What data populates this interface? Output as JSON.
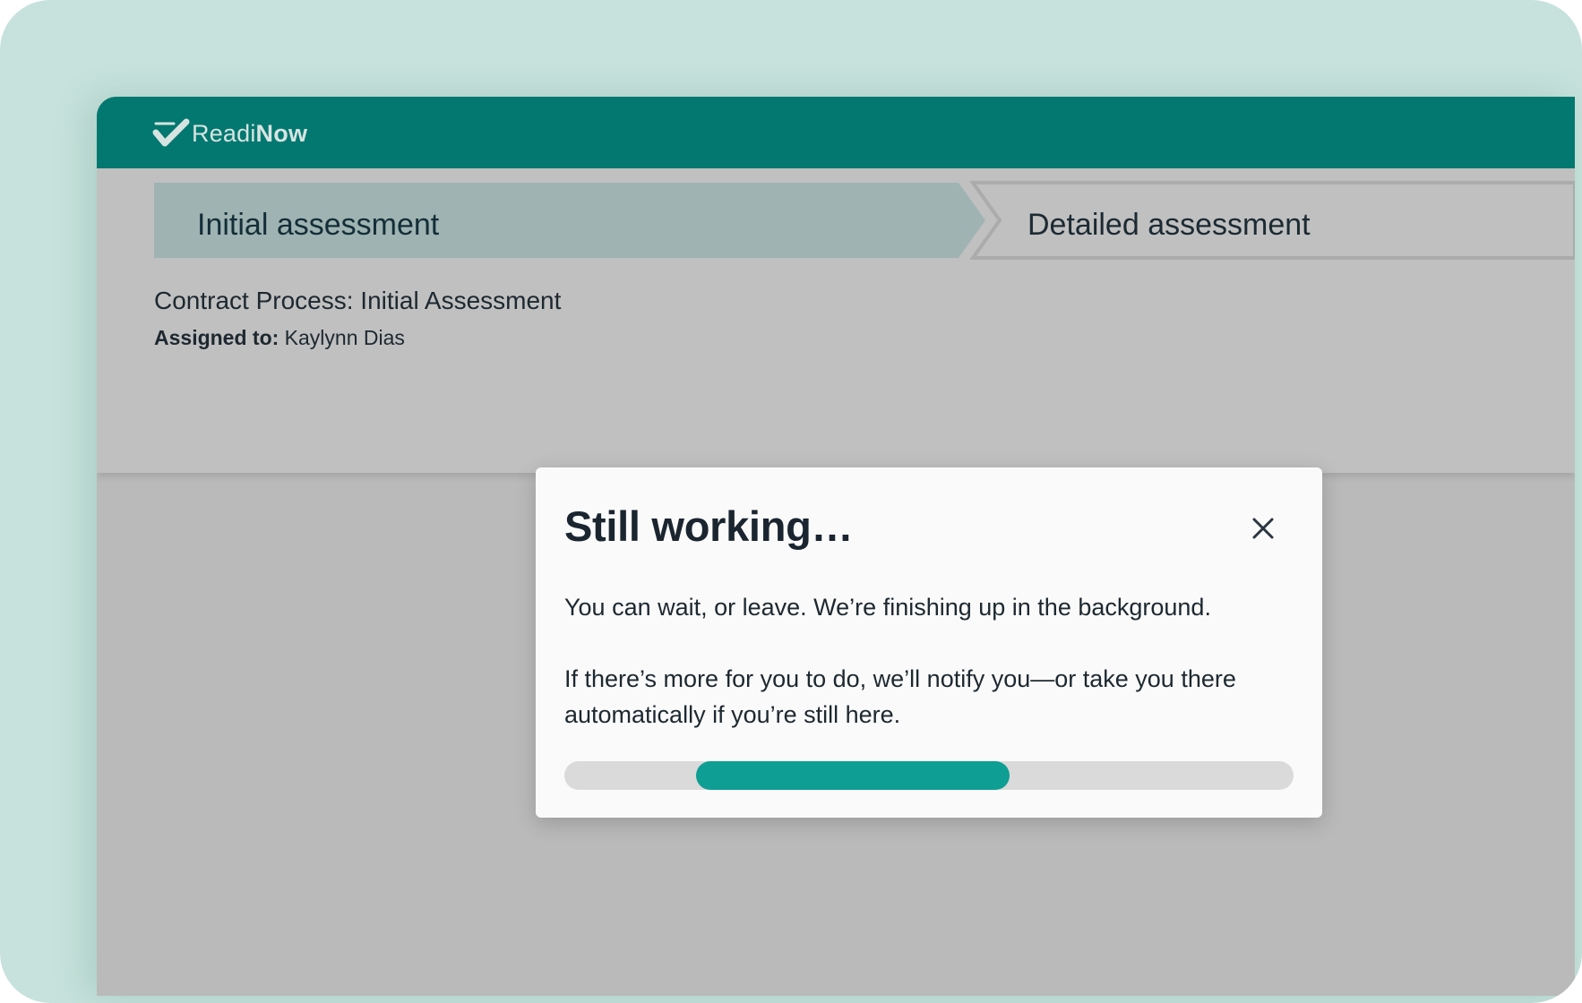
{
  "app": {
    "brand_light": "Readi",
    "brand_bold": "Now",
    "brand_color": "#037870",
    "accent_color": "#0e9e93"
  },
  "stepper": {
    "steps": [
      {
        "label": "Initial assessment",
        "state": "active"
      },
      {
        "label": "Detailed assessment",
        "state": "inactive"
      }
    ]
  },
  "process": {
    "title": "Contract Process: Initial Assessment",
    "assigned_label": "Assigned to:",
    "assigned_value": "Kaylynn Dias"
  },
  "modal": {
    "title": "Still working…",
    "close_icon": "close-icon",
    "paragraph_1": "You can wait, or leave. We’re finishing up in the background.",
    "paragraph_2": "If there’s more for you to do, we’ll notify you—or take you there automatically if you’re still here.",
    "progress": {
      "type": "indeterminate",
      "fill_start_fraction": 0.18,
      "fill_end_fraction": 0.61
    }
  }
}
